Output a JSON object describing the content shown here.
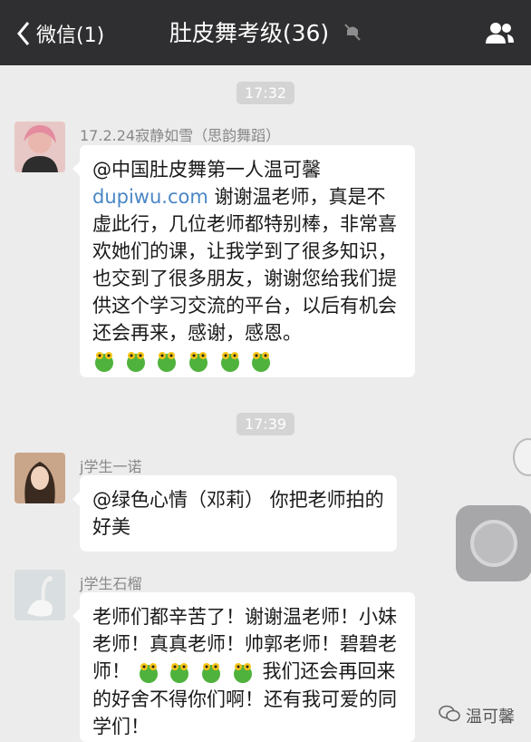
{
  "header": {
    "back_label": "微信(1)",
    "title": "肚皮舞考级(36)"
  },
  "timestamps": [
    "17:32",
    "17:39"
  ],
  "messages": [
    {
      "sender": "17.2.24寂静如雪（思韵舞蹈）",
      "line1": "@中国肚皮舞第一人温可馨",
      "link": "dupiwu.com",
      "text": "谢谢温老师，真是不虚此行，几位老师都特别棒，非常喜欢她们的课，让我学到了很多知识，也交到了很多朋友，谢谢您给我们提供这个学习交流的平台，以后有机会还会再来，感谢，感恩。"
    },
    {
      "sender": "j学生一诺",
      "text": "@绿色心情（邓莉） 你把老师拍的好美"
    },
    {
      "sender": "j学生石榴",
      "text_a": "老师们都辛苦了！谢谢温老师！小妹老师！真真老师！帅郭老师！碧碧老师！",
      "text_b": "我们还会再回来的好舍不得你们啊！还有我可爱的同学们！"
    }
  ],
  "watermark": "温可馨",
  "colors": {
    "topbar": "#2f2f31",
    "background": "#ececec",
    "link": "#4a86c5",
    "emoji_green": "#4fb23c",
    "emoji_yellow": "#f5c518"
  }
}
